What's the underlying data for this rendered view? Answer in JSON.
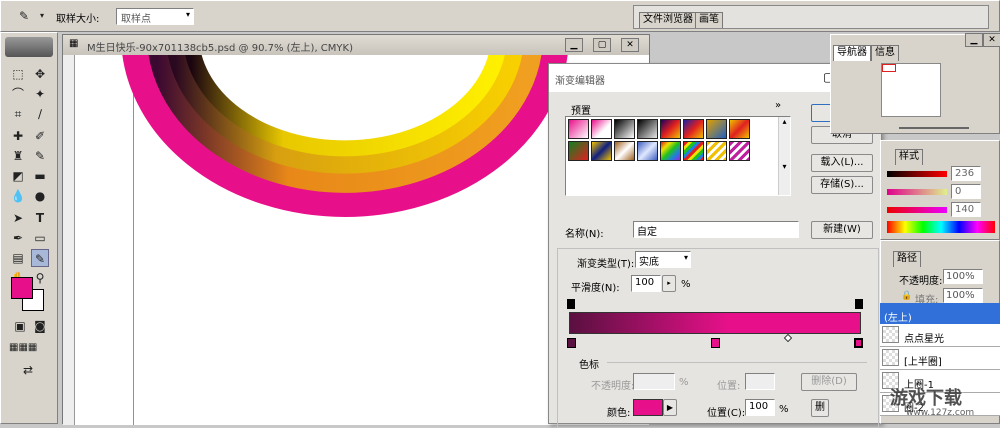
{
  "optionsBar": {
    "sampleSizeLabel": "取样大小:",
    "sampleSizeValue": "取样点"
  },
  "panelWell": {
    "tab1": "文件浏览器",
    "tab2": "画笔"
  },
  "document": {
    "title": "M生日快乐-90x701138cb5.psd @ 90.7% (左上), CMYK)"
  },
  "dialog": {
    "title": "渐变编辑器",
    "presetsLabel": "预置",
    "presetsMenu": "»",
    "okButton": "好",
    "cancelButton": "取消",
    "loadButton": "载入(L)...",
    "saveButton": "存储(S)...",
    "nameLabel": "名称(N):",
    "nameValue": "自定",
    "newButton": "新建(W)",
    "gradientTypeLabel": "渐变类型(T):",
    "gradientTypeValue": "实底",
    "smoothnessLabel": "平滑度(N):",
    "smoothnessValue": "100",
    "smoothnessUnit": "%",
    "stopsLabel": "色标",
    "opacityLabel": "不透明度:",
    "opacityUnit": "%",
    "locationLabel1": "位置:",
    "deleteButton1": "删除(D)",
    "colorLabel": "颜色:",
    "locationLabel2": "位置(C):",
    "locationValue": "100",
    "locationUnit": "%",
    "deleteButton2": "删",
    "colors": {
      "gradStart": "#5a1040",
      "gradEnd": "#e8108a",
      "stop": "#e8108a"
    }
  },
  "navigator": {
    "tab1": "导航器",
    "tab2": "信息"
  },
  "colorPanel": {
    "tab": "样式",
    "values": [
      "236",
      "0",
      "140"
    ]
  },
  "layers": {
    "tab": "路径",
    "opacityLabel": "不透明度:",
    "opacityValue": "100%",
    "fillLabel": "填充:",
    "fillValue": "100%",
    "rows": [
      "(左上)",
      "点点星光",
      "[上半圈]",
      "上圈-1",
      "圈-2"
    ]
  },
  "watermark": {
    "text": "游戏下载",
    "url": "www.127z.com"
  },
  "colors": {
    "foreground": "#e8108a",
    "background": "#ffffff"
  }
}
